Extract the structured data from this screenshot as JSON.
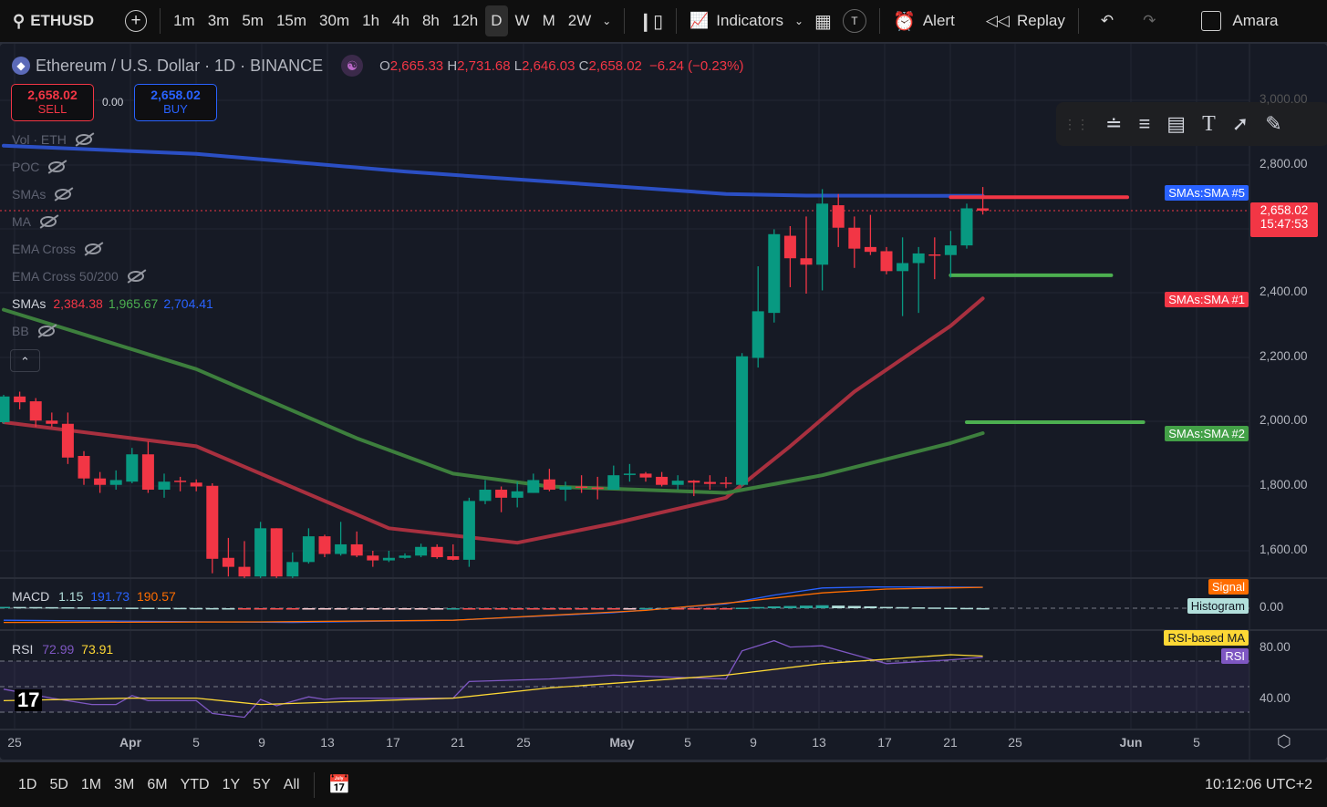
{
  "toolbar": {
    "symbol": "ETHUSD",
    "intervals": [
      "1m",
      "3m",
      "5m",
      "15m",
      "30m",
      "1h",
      "4h",
      "8h",
      "12h",
      "D",
      "W",
      "M",
      "2W"
    ],
    "selected_interval": "D",
    "indicators": "Indicators",
    "template_badge": "T",
    "alert": "Alert",
    "replay": "Replay",
    "user": "Amara"
  },
  "header": {
    "title": "Ethereum / U.S. Dollar · 1D · BINANCE",
    "o_label": "O",
    "o": "2,665.33",
    "h_label": "H",
    "h": "2,731.68",
    "l_label": "L",
    "l": "2,646.03",
    "c_label": "C",
    "c": "2,658.02",
    "change": "−6.24 (−0.23%)"
  },
  "trade": {
    "sell_price": "2,658.02",
    "sell": "SELL",
    "spread": "0.00",
    "buy_price": "2,658.02",
    "buy": "BUY"
  },
  "legend": {
    "hidden": [
      "Vol · ETH",
      "POC",
      "SMAs",
      "MA",
      "EMA Cross",
      "EMA Cross 50/200"
    ],
    "smas_label": "SMAs",
    "sma_values": [
      "2,384.38",
      "1,965.67",
      "2,704.41"
    ],
    "bb": "BB"
  },
  "macd": {
    "label": "MACD",
    "hist": "1.15",
    "macd": "191.73",
    "signal": "190.57"
  },
  "rsi": {
    "label": "RSI",
    "rsi": "72.99",
    "ma": "73.91"
  },
  "right_tags": {
    "sma5": "SMAs:SMA #5",
    "sma1": "SMAs:SMA #1",
    "sma2": "SMAs:SMA #2",
    "price": "2,658.02",
    "countdown": "15:47:53",
    "signal": "Signal",
    "histogram": "Histogram",
    "rsi_ma": "RSI-based MA",
    "rsi": "RSI"
  },
  "price_axis": [
    "3,000.00",
    "2,800.00",
    "2,400.00",
    "2,200.00",
    "2,000.00",
    "1,800.00",
    "1,600.00"
  ],
  "macd_axis": [
    "0.00"
  ],
  "rsi_axis": [
    "80.00",
    "40.00"
  ],
  "time_axis": [
    "25",
    "Apr",
    "5",
    "9",
    "13",
    "17",
    "21",
    "25",
    "May",
    "5",
    "9",
    "13",
    "17",
    "21",
    "25",
    "Jun",
    "5"
  ],
  "bottom": {
    "ranges": [
      "1D",
      "5D",
      "1M",
      "3M",
      "6M",
      "YTD",
      "1Y",
      "5Y",
      "All"
    ],
    "clock": "10:12:06 UTC+2"
  },
  "colors": {
    "up": "#089981",
    "down": "#f23645",
    "sma_blue": "#2b4fc4",
    "sma_red": "#a8303f",
    "sma_green": "#3d7f3d",
    "macd": "#2962ff",
    "signal": "#ff6d00",
    "rsi": "#7e57c2",
    "rsi_ma": "#fdd835"
  },
  "chart_data": {
    "type": "candlestick",
    "symbol": "ETHUSD",
    "timeframe": "1D",
    "ylim": [
      1500,
      3000
    ],
    "candles_ohlc": [
      [
        2000,
        2085,
        1995,
        2080
      ],
      [
        2080,
        2095,
        2040,
        2062
      ],
      [
        2065,
        2075,
        1985,
        2005
      ],
      [
        2005,
        2030,
        1985,
        1995
      ],
      [
        1995,
        2030,
        1870,
        1890
      ],
      [
        1895,
        1910,
        1805,
        1825
      ],
      [
        1825,
        1845,
        1780,
        1805
      ],
      [
        1805,
        1850,
        1790,
        1820
      ],
      [
        1815,
        1920,
        1810,
        1900
      ],
      [
        1900,
        1940,
        1780,
        1790
      ],
      [
        1790,
        1840,
        1765,
        1815
      ],
      [
        1818,
        1830,
        1785,
        1815
      ],
      [
        1812,
        1822,
        1785,
        1800
      ],
      [
        1802,
        1810,
        1530,
        1575
      ],
      [
        1578,
        1640,
        1520,
        1550
      ],
      [
        1550,
        1630,
        1515,
        1520
      ],
      [
        1520,
        1690,
        1515,
        1670
      ],
      [
        1670,
        1670,
        1515,
        1520
      ],
      [
        1520,
        1595,
        1515,
        1565
      ],
      [
        1565,
        1670,
        1560,
        1645
      ],
      [
        1645,
        1650,
        1580,
        1590
      ],
      [
        1590,
        1690,
        1585,
        1620
      ],
      [
        1620,
        1660,
        1580,
        1585
      ],
      [
        1585,
        1600,
        1550,
        1570
      ],
      [
        1570,
        1600,
        1565,
        1578
      ],
      [
        1578,
        1592,
        1575,
        1585
      ],
      [
        1585,
        1622,
        1580,
        1612
      ],
      [
        1612,
        1620,
        1575,
        1580
      ],
      [
        1583,
        1620,
        1570,
        1572
      ],
      [
        1572,
        1765,
        1550,
        1755
      ],
      [
        1755,
        1820,
        1745,
        1790
      ],
      [
        1790,
        1800,
        1720,
        1765
      ],
      [
        1765,
        1815,
        1735,
        1785
      ],
      [
        1780,
        1840,
        1780,
        1820
      ],
      [
        1822,
        1855,
        1785,
        1790
      ],
      [
        1790,
        1815,
        1755,
        1800
      ],
      [
        1800,
        1835,
        1780,
        1797
      ],
      [
        1797,
        1830,
        1760,
        1792
      ],
      [
        1790,
        1865,
        1790,
        1835
      ],
      [
        1838,
        1870,
        1815,
        1840
      ],
      [
        1840,
        1845,
        1815,
        1828
      ],
      [
        1830,
        1845,
        1800,
        1805
      ],
      [
        1805,
        1835,
        1790,
        1818
      ],
      [
        1818,
        1820,
        1770,
        1812
      ],
      [
        1814,
        1835,
        1790,
        1808
      ],
      [
        1812,
        1830,
        1795,
        1808
      ],
      [
        1805,
        2215,
        1800,
        2205
      ],
      [
        2200,
        2485,
        2170,
        2345
      ],
      [
        2340,
        2600,
        2310,
        2585
      ],
      [
        2580,
        2610,
        2420,
        2510
      ],
      [
        2510,
        2640,
        2400,
        2490
      ],
      [
        2490,
        2725,
        2410,
        2680
      ],
      [
        2675,
        2710,
        2545,
        2605
      ],
      [
        2605,
        2640,
        2480,
        2540
      ],
      [
        2545,
        2645,
        2520,
        2530
      ],
      [
        2532,
        2545,
        2460,
        2470
      ],
      [
        2470,
        2575,
        2330,
        2495
      ],
      [
        2495,
        2545,
        2340,
        2525
      ],
      [
        2522,
        2575,
        2445,
        2518
      ],
      [
        2520,
        2595,
        2450,
        2550
      ],
      [
        2550,
        2680,
        2540,
        2665.33
      ],
      [
        2665.33,
        2731.68,
        2646.03,
        2658.02
      ]
    ],
    "sma_series": [
      {
        "name": "SMA #1",
        "value": "2,384.38",
        "points": [
          [
            0,
            2000
          ],
          [
            12,
            1925
          ],
          [
            24,
            1670
          ],
          [
            32,
            1625
          ],
          [
            38,
            1685
          ],
          [
            45,
            1765
          ],
          [
            49,
            1925
          ],
          [
            53,
            2095
          ],
          [
            59,
            2300
          ],
          [
            61,
            2385
          ]
        ]
      },
      {
        "name": "SMA #2",
        "value": "1,965.67",
        "points": [
          [
            0,
            2350
          ],
          [
            12,
            2165
          ],
          [
            22,
            1950
          ],
          [
            28,
            1840
          ],
          [
            34,
            1800
          ],
          [
            45,
            1780
          ],
          [
            51,
            1835
          ],
          [
            59,
            1935
          ],
          [
            61,
            1966
          ]
        ]
      },
      {
        "name": "SMA #5",
        "value": "2,704.41",
        "points": [
          [
            0,
            2860
          ],
          [
            12,
            2835
          ],
          [
            25,
            2780
          ],
          [
            35,
            2745
          ],
          [
            45,
            2710
          ],
          [
            50,
            2705
          ],
          [
            61,
            2704
          ]
        ]
      }
    ],
    "horizontal_lines": [
      {
        "price": 2700,
        "from": 59,
        "to": 70,
        "color": "red"
      },
      {
        "price": 2457,
        "from": 59,
        "to": 69,
        "color": "green"
      },
      {
        "price": 2000,
        "from": 60,
        "to": 71,
        "color": "green"
      }
    ],
    "last_price": 2658.02,
    "macd_line": [
      [
        0,
        -110
      ],
      [
        18,
        -130
      ],
      [
        28,
        -110
      ],
      [
        38,
        -40
      ],
      [
        45,
        40
      ],
      [
        48,
        120
      ],
      [
        51,
        185
      ],
      [
        54,
        195
      ],
      [
        61,
        191.73
      ]
    ],
    "signal_line": [
      [
        0,
        -130
      ],
      [
        16,
        -125
      ],
      [
        28,
        -110
      ],
      [
        40,
        -20
      ],
      [
        46,
        60
      ],
      [
        51,
        140
      ],
      [
        55,
        175
      ],
      [
        61,
        190.57
      ]
    ],
    "rsi_line": [
      [
        0,
        48
      ],
      [
        3,
        41
      ],
      [
        5.5,
        36
      ],
      [
        7,
        36
      ],
      [
        8,
        43
      ],
      [
        9,
        39
      ],
      [
        12,
        39
      ],
      [
        13,
        29
      ],
      [
        15,
        26
      ],
      [
        16,
        40
      ],
      [
        17,
        35
      ],
      [
        19,
        42
      ],
      [
        20,
        40
      ],
      [
        21,
        41
      ],
      [
        28,
        41
      ],
      [
        29,
        54
      ],
      [
        34,
        56
      ],
      [
        38,
        59
      ],
      [
        45,
        56
      ],
      [
        46,
        78
      ],
      [
        48,
        86
      ],
      [
        49,
        81
      ],
      [
        51,
        82
      ],
      [
        53,
        75
      ],
      [
        55,
        68
      ],
      [
        59,
        71
      ],
      [
        61,
        72.99
      ]
    ],
    "rsi_ma_line": [
      [
        0,
        39
      ],
      [
        8,
        41
      ],
      [
        12,
        41
      ],
      [
        16,
        36
      ],
      [
        28,
        41
      ],
      [
        34,
        49
      ],
      [
        45,
        59
      ],
      [
        51,
        68
      ],
      [
        59,
        75
      ],
      [
        61,
        73.91
      ]
    ],
    "rsi_bands": [
      70,
      50,
      30
    ]
  }
}
